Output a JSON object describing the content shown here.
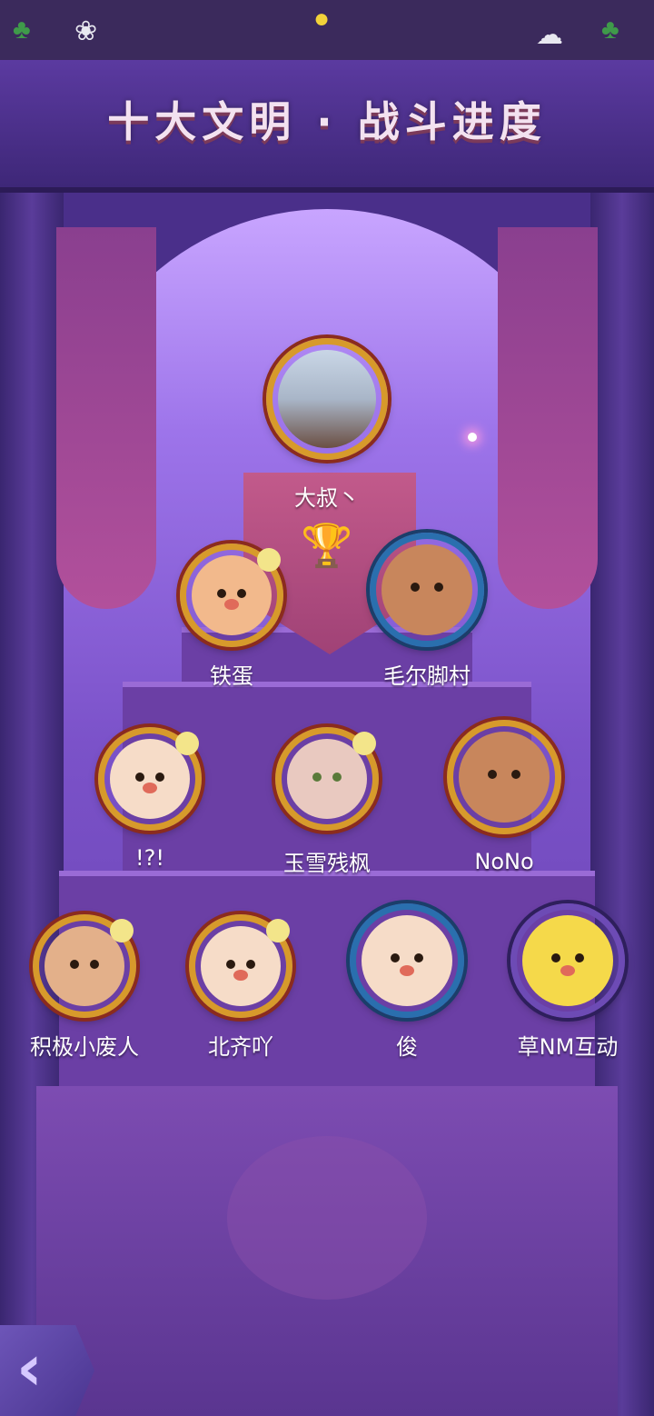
{
  "header": {
    "title_left": "十大文明",
    "title_sep": "·",
    "title_right": "战斗进度"
  },
  "players": {
    "top": {
      "name": "大叔丶"
    },
    "row2": [
      {
        "name": "铁蛋"
      },
      {
        "name": "毛尔脚村"
      }
    ],
    "row3": [
      {
        "name": "!?!"
      },
      {
        "name": "玉雪残枫"
      },
      {
        "name": "NoNo"
      }
    ],
    "row4": [
      {
        "name": "积极小废人"
      },
      {
        "name": "北齐吖"
      },
      {
        "name": "俊"
      },
      {
        "name": "草NM互动"
      }
    ]
  },
  "nav": {
    "back_icon": "chevron-left-icon"
  },
  "colors": {
    "gold_frame": "#d79a2b",
    "blue_frame": "#2a6fae",
    "background": "#4a2f8a",
    "banner": "#a04276"
  }
}
